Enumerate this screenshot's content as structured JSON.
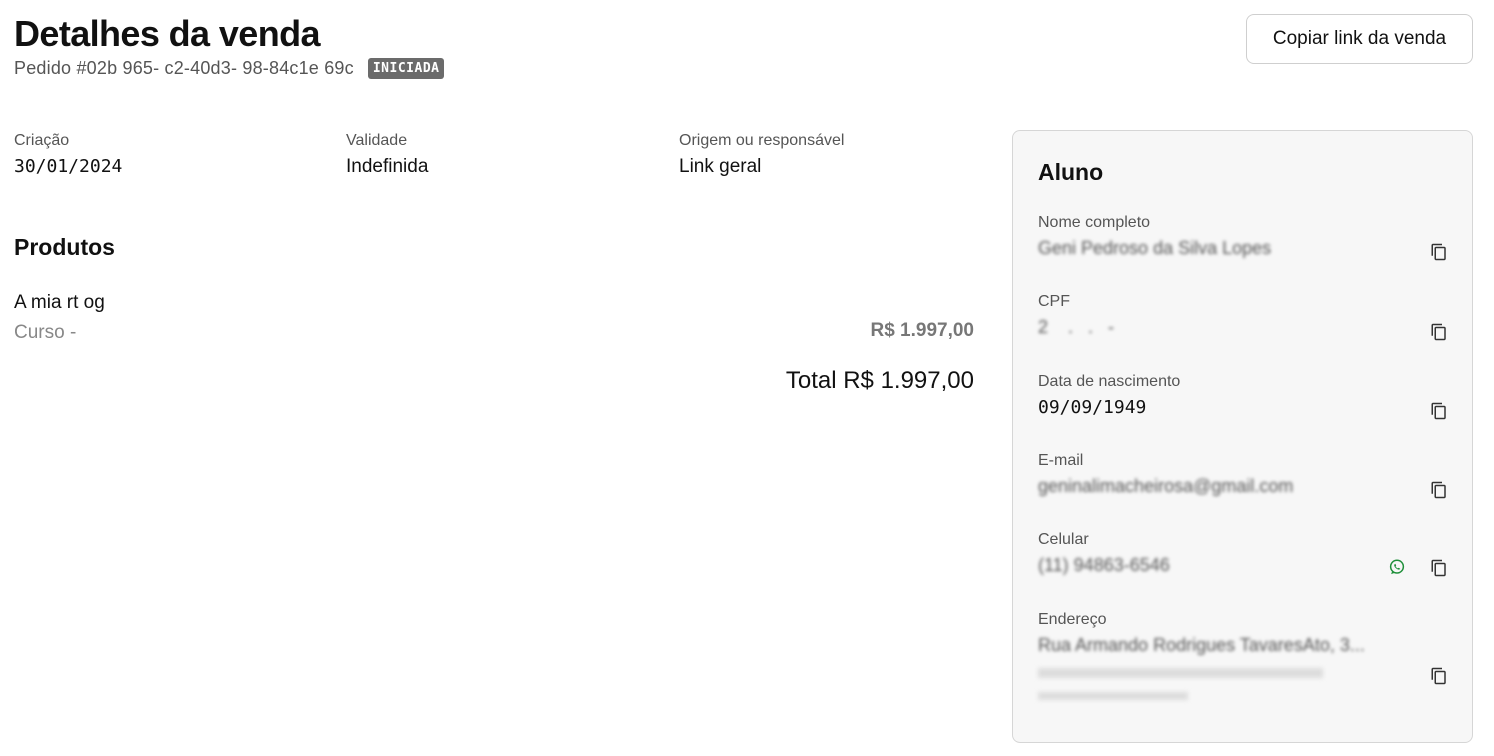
{
  "header": {
    "title": "Detalhes da venda",
    "order_id": "Pedido #02b 965- c2-40d3- 98-84c1e 69c",
    "status": "INICIADA",
    "copy_link_label": "Copiar link da venda"
  },
  "info": [
    {
      "label": "Criação",
      "value": "30/01/2024"
    },
    {
      "label": "Validade",
      "value": "Indefinida"
    },
    {
      "label": "Origem ou responsável",
      "value": "Link geral"
    }
  ],
  "products": {
    "title": "Produtos",
    "items": [
      {
        "name": "A mia rt og",
        "type": "Curso -",
        "price": "R$ 1.997,00"
      }
    ],
    "total": "Total R$ 1.997,00"
  },
  "student": {
    "title": "Aluno",
    "fields": [
      {
        "label": "Nome completo",
        "value": "Geni Pedroso da Silva Lopes"
      },
      {
        "label": "CPF",
        "value": "2    .   .   -  "
      },
      {
        "label": "Data de nascimento",
        "value": "09/09/1949"
      },
      {
        "label": "E-mail",
        "value": "geninalimacheirosa@gmail.com"
      },
      {
        "label": "Celular",
        "value": "(11) 94863-6546"
      },
      {
        "label": "Endereço",
        "value": "Rua Armando Rodrigues TavaresAto, 3..."
      }
    ]
  },
  "colors": {
    "badge": "#6b6b6b",
    "whatsapp": "#1f8f3a",
    "card_bg": "#f7f7f7"
  }
}
